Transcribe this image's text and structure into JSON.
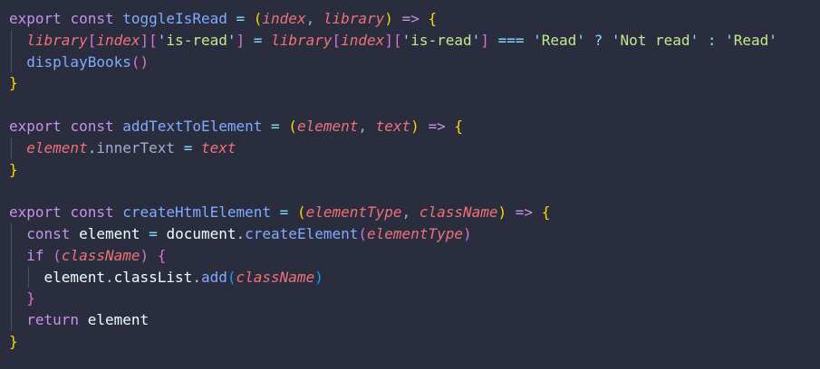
{
  "editor": {
    "lines": [
      [
        {
          "t": "export",
          "c": "kw"
        },
        {
          "t": " ",
          "c": "plain"
        },
        {
          "t": "const",
          "c": "kw"
        },
        {
          "t": " ",
          "c": "plain"
        },
        {
          "t": "toggleIsRead",
          "c": "fn"
        },
        {
          "t": " ",
          "c": "plain"
        },
        {
          "t": "=",
          "c": "op"
        },
        {
          "t": " ",
          "c": "plain"
        },
        {
          "t": "(",
          "c": "br1"
        },
        {
          "t": "index",
          "c": "param"
        },
        {
          "t": ", ",
          "c": "plain"
        },
        {
          "t": "library",
          "c": "param"
        },
        {
          "t": ")",
          "c": "br1"
        },
        {
          "t": " ",
          "c": "plain"
        },
        {
          "t": "=>",
          "c": "kw"
        },
        {
          "t": " ",
          "c": "plain"
        },
        {
          "t": "{",
          "c": "br1"
        }
      ],
      [
        {
          "t": "  ",
          "c": "plain",
          "guide": true
        },
        {
          "t": "library",
          "c": "param"
        },
        {
          "t": "[",
          "c": "br2"
        },
        {
          "t": "index",
          "c": "param"
        },
        {
          "t": "][",
          "c": "br2"
        },
        {
          "t": "'",
          "c": "pun"
        },
        {
          "t": "is-read",
          "c": "str"
        },
        {
          "t": "'",
          "c": "pun"
        },
        {
          "t": "]",
          "c": "br2"
        },
        {
          "t": " ",
          "c": "plain"
        },
        {
          "t": "=",
          "c": "op"
        },
        {
          "t": " ",
          "c": "plain"
        },
        {
          "t": "library",
          "c": "param"
        },
        {
          "t": "[",
          "c": "br2"
        },
        {
          "t": "index",
          "c": "param"
        },
        {
          "t": "][",
          "c": "br2"
        },
        {
          "t": "'",
          "c": "pun"
        },
        {
          "t": "is-read",
          "c": "str"
        },
        {
          "t": "'",
          "c": "pun"
        },
        {
          "t": "]",
          "c": "br2"
        },
        {
          "t": " ",
          "c": "plain"
        },
        {
          "t": "===",
          "c": "op"
        },
        {
          "t": " ",
          "c": "plain"
        },
        {
          "t": "'",
          "c": "pun"
        },
        {
          "t": "Read",
          "c": "str"
        },
        {
          "t": "'",
          "c": "pun"
        },
        {
          "t": " ",
          "c": "plain"
        },
        {
          "t": "?",
          "c": "op"
        },
        {
          "t": " ",
          "c": "plain"
        },
        {
          "t": "'",
          "c": "pun"
        },
        {
          "t": "Not read",
          "c": "str"
        },
        {
          "t": "'",
          "c": "pun"
        },
        {
          "t": " ",
          "c": "plain"
        },
        {
          "t": ":",
          "c": "op"
        },
        {
          "t": " ",
          "c": "plain"
        },
        {
          "t": "'",
          "c": "pun"
        },
        {
          "t": "Read",
          "c": "str"
        },
        {
          "t": "'",
          "c": "pun"
        }
      ],
      [
        {
          "t": "  ",
          "c": "plain",
          "guide": true
        },
        {
          "t": "displayBooks",
          "c": "fn"
        },
        {
          "t": "()",
          "c": "br2"
        }
      ],
      [
        {
          "t": "}",
          "c": "br1"
        }
      ],
      [],
      [
        {
          "t": "export",
          "c": "kw"
        },
        {
          "t": " ",
          "c": "plain"
        },
        {
          "t": "const",
          "c": "kw"
        },
        {
          "t": " ",
          "c": "plain"
        },
        {
          "t": "addTextToElement",
          "c": "fn"
        },
        {
          "t": " ",
          "c": "plain"
        },
        {
          "t": "=",
          "c": "op"
        },
        {
          "t": " ",
          "c": "plain"
        },
        {
          "t": "(",
          "c": "br1"
        },
        {
          "t": "element",
          "c": "param"
        },
        {
          "t": ", ",
          "c": "plain"
        },
        {
          "t": "text",
          "c": "param"
        },
        {
          "t": ")",
          "c": "br1"
        },
        {
          "t": " ",
          "c": "plain"
        },
        {
          "t": "=>",
          "c": "kw"
        },
        {
          "t": " ",
          "c": "plain"
        },
        {
          "t": "{",
          "c": "br1"
        }
      ],
      [
        {
          "t": "  ",
          "c": "plain",
          "guide": true
        },
        {
          "t": "element",
          "c": "param"
        },
        {
          "t": ".",
          "c": "op"
        },
        {
          "t": "innerText",
          "c": "plain"
        },
        {
          "t": " ",
          "c": "plain"
        },
        {
          "t": "=",
          "c": "op"
        },
        {
          "t": " ",
          "c": "plain"
        },
        {
          "t": "text",
          "c": "param"
        }
      ],
      [
        {
          "t": "}",
          "c": "br1"
        }
      ],
      [],
      [
        {
          "t": "export",
          "c": "kw"
        },
        {
          "t": " ",
          "c": "plain"
        },
        {
          "t": "const",
          "c": "kw"
        },
        {
          "t": " ",
          "c": "plain"
        },
        {
          "t": "createHtmlElement",
          "c": "fn"
        },
        {
          "t": " ",
          "c": "plain"
        },
        {
          "t": "=",
          "c": "op"
        },
        {
          "t": " ",
          "c": "plain"
        },
        {
          "t": "(",
          "c": "br1"
        },
        {
          "t": "elementType",
          "c": "param"
        },
        {
          "t": ", ",
          "c": "plain"
        },
        {
          "t": "className",
          "c": "param"
        },
        {
          "t": ")",
          "c": "br1"
        },
        {
          "t": " ",
          "c": "plain"
        },
        {
          "t": "=>",
          "c": "kw"
        },
        {
          "t": " ",
          "c": "plain"
        },
        {
          "t": "{",
          "c": "br1"
        }
      ],
      [
        {
          "t": "  ",
          "c": "plain",
          "guide": true
        },
        {
          "t": "const",
          "c": "kw"
        },
        {
          "t": " ",
          "c": "plain"
        },
        {
          "t": "element",
          "c": "var"
        },
        {
          "t": " ",
          "c": "plain"
        },
        {
          "t": "=",
          "c": "op"
        },
        {
          "t": " ",
          "c": "plain"
        },
        {
          "t": "document",
          "c": "var"
        },
        {
          "t": ".",
          "c": "op"
        },
        {
          "t": "createElement",
          "c": "fn"
        },
        {
          "t": "(",
          "c": "br2"
        },
        {
          "t": "elementType",
          "c": "param"
        },
        {
          "t": ")",
          "c": "br2"
        }
      ],
      [
        {
          "t": "  ",
          "c": "plain",
          "guide": true
        },
        {
          "t": "if",
          "c": "kw"
        },
        {
          "t": " ",
          "c": "plain"
        },
        {
          "t": "(",
          "c": "br2"
        },
        {
          "t": "className",
          "c": "param"
        },
        {
          "t": ")",
          "c": "br2"
        },
        {
          "t": " ",
          "c": "plain"
        },
        {
          "t": "{",
          "c": "br2"
        }
      ],
      [
        {
          "t": "  ",
          "c": "plain",
          "guide": true
        },
        {
          "t": "  ",
          "c": "plain",
          "guide2": true
        },
        {
          "t": "element",
          "c": "var"
        },
        {
          "t": ".",
          "c": "op"
        },
        {
          "t": "classList",
          "c": "var"
        },
        {
          "t": ".",
          "c": "op"
        },
        {
          "t": "add",
          "c": "fn"
        },
        {
          "t": "(",
          "c": "br3"
        },
        {
          "t": "className",
          "c": "param"
        },
        {
          "t": ")",
          "c": "br3"
        }
      ],
      [
        {
          "t": "  ",
          "c": "plain",
          "guide": true
        },
        {
          "t": "}",
          "c": "br2"
        }
      ],
      [
        {
          "t": "  ",
          "c": "plain",
          "guide": true
        },
        {
          "t": "return",
          "c": "kw"
        },
        {
          "t": " ",
          "c": "plain"
        },
        {
          "t": "element",
          "c": "var"
        }
      ],
      [
        {
          "t": "}",
          "c": "br1"
        }
      ]
    ]
  }
}
